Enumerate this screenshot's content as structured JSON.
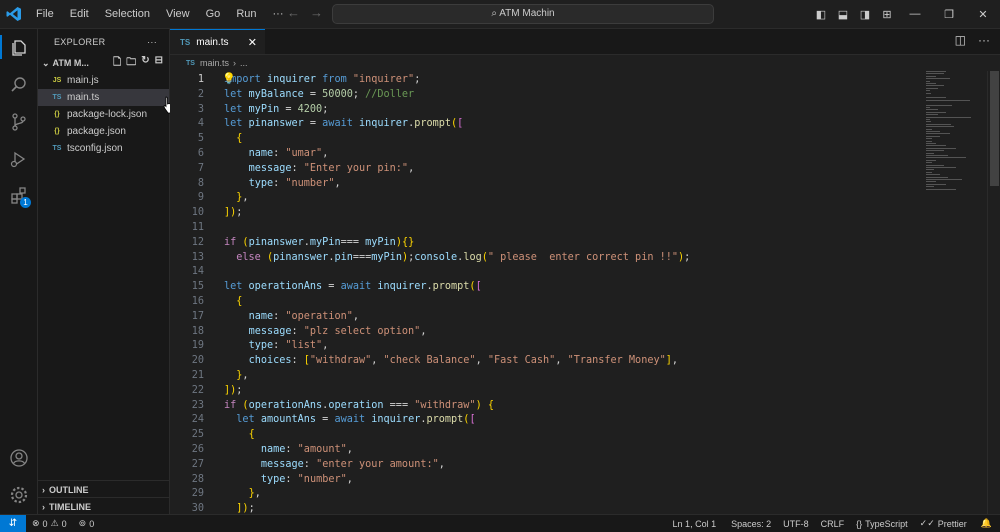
{
  "titlebar": {
    "menu": [
      "File",
      "Edit",
      "Selection",
      "View",
      "Go",
      "Run",
      "···"
    ],
    "search_label": "ATM Machin"
  },
  "activity_bar": {
    "extensions_badge": "1"
  },
  "sidebar": {
    "title": "EXPLORER",
    "folder": "ATM M...",
    "files": [
      {
        "name": "main.js",
        "icon": "JS",
        "icon_color": "#cbcb41"
      },
      {
        "name": "main.ts",
        "icon": "TS",
        "icon_color": "#519aba"
      },
      {
        "name": "package-lock.json",
        "icon": "{}",
        "icon_color": "#cbcb41"
      },
      {
        "name": "package.json",
        "icon": "{}",
        "icon_color": "#cbcb41"
      },
      {
        "name": "tsconfig.json",
        "icon": "TS",
        "icon_color": "#519aba"
      }
    ],
    "outline": "OUTLINE",
    "timeline": "TIMELINE"
  },
  "tab": {
    "icon": "TS",
    "label": "main.ts",
    "close": "✕"
  },
  "breadcrumb": {
    "icon": "TS",
    "file": "main.ts",
    "sep": "›",
    "rest": "..."
  },
  "editor": {
    "line_numbers": [
      "1",
      "2",
      "3",
      "4",
      "5",
      "6",
      "7",
      "8",
      "9",
      "10",
      "11",
      "12",
      "13",
      "14",
      "15",
      "16",
      "17",
      "18",
      "19",
      "20",
      "21",
      "22",
      "23",
      "24",
      "25",
      "26",
      "27",
      "28",
      "29",
      "30"
    ],
    "lines": [
      "import inquirer from \"inquirer\";",
      "let myBalance = 50000; //Doller",
      "let myPin = 4200;",
      "let pinanswer = await inquirer.prompt([",
      "  {",
      "    name: \"umar\",",
      "    message: \"Enter your pin:\",",
      "    type: \"number\",",
      "  },",
      "]);",
      "",
      "if (pinanswer.myPin=== myPin){}",
      "  else (pinanswer.pin===myPin);console.log(\" please  enter correct pin !!\");",
      "",
      "let operationAns = await inquirer.prompt([",
      "  {",
      "    name: \"operation\",",
      "    message: \"plz select option\",",
      "    type: \"list\",",
      "    choices: [\"withdraw\", \"check Balance\", \"Fast Cash\", \"Transfer Money\"],",
      "  },",
      "]);",
      "if (operationAns.operation === \"withdraw\") {",
      "  let amountAns = await inquirer.prompt([",
      "    {",
      "      name: \"amount\",",
      "      message: \"enter your amount:\",",
      "      type: \"number\",",
      "    },",
      "  ]);"
    ]
  },
  "statusbar": {
    "errors": "0",
    "warnings": "0",
    "ports": "0",
    "position": "Ln 1, Col 1",
    "spaces": "Spaces: 2",
    "encoding": "UTF-8",
    "eol": "CRLF",
    "language": "TypeScript",
    "formatter": "Prettier"
  }
}
